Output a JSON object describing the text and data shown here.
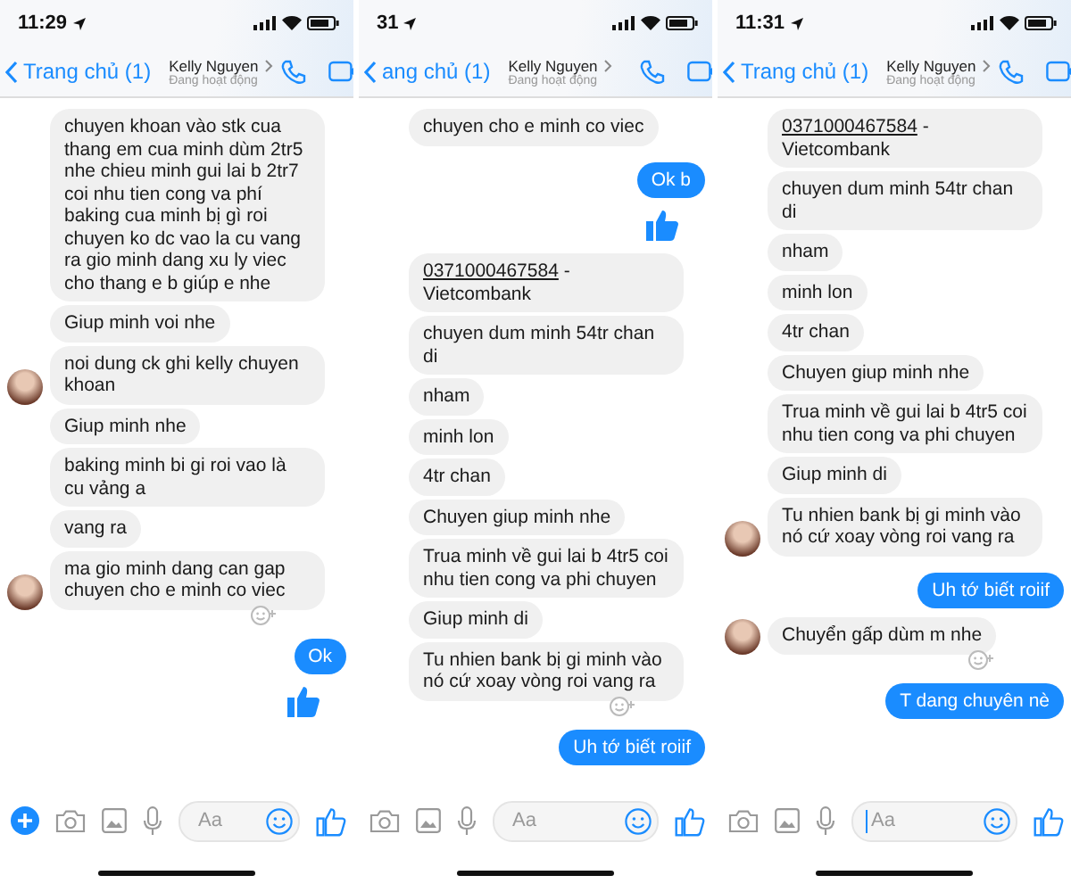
{
  "panels": [
    {
      "time": "11:29",
      "back_label": "Trang chủ (1)",
      "contact_name": "Kelly Nguyen",
      "contact_status": "Đang hoạt động",
      "composer": {
        "placeholder": "Aa",
        "show_plus": true,
        "cursor": false
      },
      "messages": [
        {
          "kind": "received",
          "text": "chuyen khoan vào stk cua thang em cua minh dùm 2tr5 nhe chieu minh gui lai b 2tr7 coi nhu tien cong va phí baking cua minh bị gì roi chuyen ko dc vao la cu vang ra gio minh dang xu ly viec cho thang e  b  giúp e nhe"
        },
        {
          "kind": "received",
          "text": "Giup minh voi nhe"
        },
        {
          "kind": "received",
          "text": "noi dung ck ghi kelly chuyen khoan",
          "avatar": true
        },
        {
          "kind": "received",
          "text": "Giup minh nhe"
        },
        {
          "kind": "received",
          "text": "baking minh bi gi roi vao là cu vảng a"
        },
        {
          "kind": "received",
          "text": "vang ra"
        },
        {
          "kind": "received",
          "text": "ma gio minh dang can gap chuyen cho e minh co viec",
          "avatar": true,
          "reaction_icon": true
        },
        {
          "kind": "sent",
          "text": "Ok"
        },
        {
          "kind": "like"
        }
      ]
    },
    {
      "time": "31",
      "back_label": "ang chủ (1)",
      "contact_name": "Kelly Nguyen",
      "contact_status": "Đang hoạt động",
      "composer": {
        "placeholder": "Aa",
        "show_plus": false,
        "cursor": false
      },
      "messages": [
        {
          "kind": "received",
          "text": "chuyen cho e minh co viec"
        },
        {
          "kind": "sent",
          "text": "Ok b"
        },
        {
          "kind": "like"
        },
        {
          "kind": "received_account",
          "link": "0371000467584",
          "text": " - Vietcombank"
        },
        {
          "kind": "received",
          "text": "chuyen dum minh 54tr chan di"
        },
        {
          "kind": "received",
          "text": "nham"
        },
        {
          "kind": "received",
          "text": "minh lon"
        },
        {
          "kind": "received",
          "text": "4tr chan"
        },
        {
          "kind": "received",
          "text": "Chuyen giup minh nhe"
        },
        {
          "kind": "received",
          "text": "Trua minh về gui lai b 4tr5 coi nhu tien cong va phi chuyen"
        },
        {
          "kind": "received",
          "text": "Giup minh di"
        },
        {
          "kind": "received",
          "text": "Tu nhien bank bị gi minh vào nó cứ xoay vòng roi vang ra",
          "reaction_icon": true
        },
        {
          "kind": "sent",
          "text": "Uh tớ biết roiif"
        }
      ]
    },
    {
      "time": "11:31",
      "back_label": "Trang chủ (1)",
      "contact_name": "Kelly Nguyen",
      "contact_status": "Đang hoạt động",
      "composer": {
        "placeholder": "Aa",
        "show_plus": false,
        "cursor": true
      },
      "messages": [
        {
          "kind": "received_account",
          "link": "0371000467584",
          "text": " - Vietcombank"
        },
        {
          "kind": "received",
          "text": "chuyen dum minh 54tr chan di"
        },
        {
          "kind": "received",
          "text": "nham"
        },
        {
          "kind": "received",
          "text": "minh lon"
        },
        {
          "kind": "received",
          "text": "4tr chan"
        },
        {
          "kind": "received",
          "text": "Chuyen giup minh nhe"
        },
        {
          "kind": "received",
          "text": "Trua minh về gui lai b 4tr5 coi nhu tien cong va phi chuyen"
        },
        {
          "kind": "received",
          "text": "Giup minh di"
        },
        {
          "kind": "received",
          "text": "Tu nhien bank bị gi minh vào nó cứ xoay vòng roi vang ra",
          "avatar": true
        },
        {
          "kind": "sent",
          "text": "Uh tớ biết roiif"
        },
        {
          "kind": "received",
          "text": "Chuyển gấp dùm m nhe",
          "avatar": true,
          "reaction_icon": true
        },
        {
          "kind": "sent",
          "text": "T dang chuyên nè"
        }
      ]
    }
  ]
}
